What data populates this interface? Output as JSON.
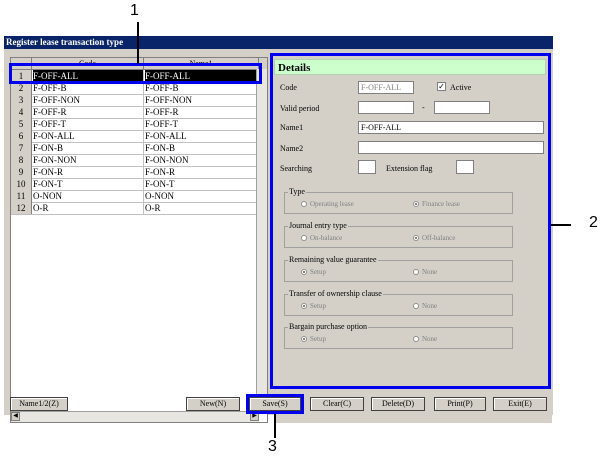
{
  "window": {
    "title": "Register lease transaction type"
  },
  "grid": {
    "columns": [
      "Code",
      "Name1"
    ],
    "rows": [
      {
        "num": "1",
        "code": "F-OFF-ALL",
        "name": "F-OFF-ALL"
      },
      {
        "num": "2",
        "code": "F-OFF-B",
        "name": "F-OFF-B"
      },
      {
        "num": "3",
        "code": "F-OFF-NON",
        "name": "F-OFF-NON"
      },
      {
        "num": "4",
        "code": "F-OFF-R",
        "name": "F-OFF-R"
      },
      {
        "num": "5",
        "code": "F-OFF-T",
        "name": "F-OFF-T"
      },
      {
        "num": "6",
        "code": "F-ON-ALL",
        "name": "F-ON-ALL"
      },
      {
        "num": "7",
        "code": "F-ON-B",
        "name": "F-ON-B"
      },
      {
        "num": "8",
        "code": "F-ON-NON",
        "name": "F-ON-NON"
      },
      {
        "num": "9",
        "code": "F-ON-R",
        "name": "F-ON-R"
      },
      {
        "num": "10",
        "code": "F-ON-T",
        "name": "F-ON-T"
      },
      {
        "num": "11",
        "code": "O-NON",
        "name": "O-NON"
      },
      {
        "num": "12",
        "code": "O-R",
        "name": "O-R"
      }
    ]
  },
  "details": {
    "title": "Details",
    "code_label": "Code",
    "code_value": "F-OFF-ALL",
    "active_label": "Active",
    "valid_period_label": "Valid period",
    "period_sep": "-",
    "name1_label": "Name1",
    "name1_value": "F-OFF-ALL",
    "name2_label": "Name2",
    "searching_label": "Searching",
    "extension_flag_label": "Extension flag",
    "type": {
      "title": "Type",
      "opt1": "Operating lease",
      "opt2": "Finance lease"
    },
    "journal": {
      "title": "Journal entry type",
      "opt1": "On-balance",
      "opt2": "Off-balance"
    },
    "remaining": {
      "title": "Remaining value guarantee",
      "opt1": "Setup",
      "opt2": "None"
    },
    "transfer": {
      "title": "Transfer of ownership clause",
      "opt1": "Setup",
      "opt2": "None"
    },
    "bargain": {
      "title": "Bargain purchase option",
      "opt1": "Setup",
      "opt2": "None"
    }
  },
  "buttons": {
    "name": "Name1/2(Z)",
    "new": "New(N)",
    "save": "Save(S)",
    "clear": "Clear(C)",
    "delete": "Delete(D)",
    "print": "Print(P)",
    "exit": "Exit(E)"
  },
  "callouts": {
    "c1": "1",
    "c2": "2",
    "c3": "3"
  },
  "colors": {
    "titlebar": "#0a246a",
    "details_header": "#ccffcc",
    "callout": "#0000ee"
  }
}
